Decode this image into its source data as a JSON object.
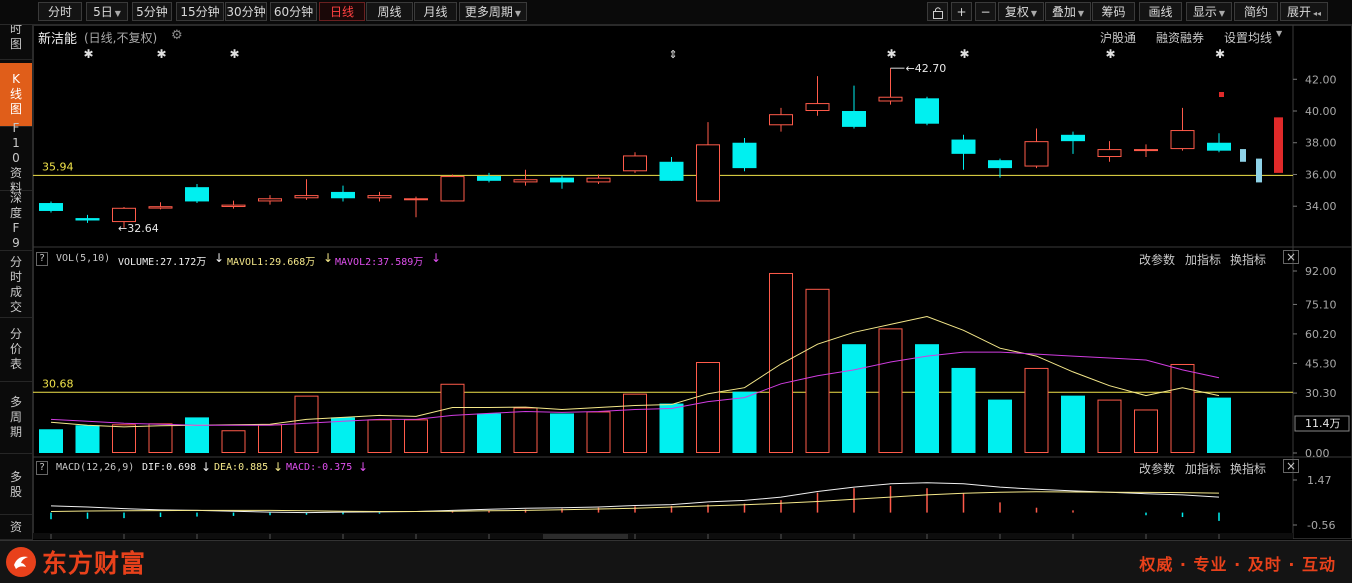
{
  "toolbar": {
    "left": [
      {
        "label": "分时",
        "caret": false,
        "active": false
      },
      {
        "label": "5日",
        "caret": true,
        "active": false
      },
      {
        "label": "5分钟",
        "caret": false,
        "active": false
      },
      {
        "label": "15分钟",
        "caret": false,
        "active": false
      },
      {
        "label": "30分钟",
        "caret": false,
        "active": false
      },
      {
        "label": "60分钟",
        "caret": false,
        "active": false
      },
      {
        "label": "日线",
        "caret": false,
        "active": true
      },
      {
        "label": "周线",
        "caret": false,
        "active": false
      },
      {
        "label": "月线",
        "caret": false,
        "active": false
      },
      {
        "label": "更多周期",
        "caret": true,
        "active": false
      }
    ],
    "right": [
      {
        "label": "复权",
        "caret": true
      },
      {
        "label": "叠加",
        "caret": true
      },
      {
        "label": "筹码",
        "caret": false
      },
      {
        "label": "画线",
        "caret": false
      },
      {
        "label": "显示",
        "caret": true
      },
      {
        "label": "简约",
        "caret": false
      },
      {
        "label": "展开",
        "caret": false
      }
    ],
    "icons": {
      "lock": "lock-icon",
      "plus": "+",
      "minus": "−",
      "collapse": "◂◂"
    }
  },
  "sidebar": [
    {
      "label": "分时图",
      "active": false
    },
    {
      "label": "K线图",
      "active": true
    },
    {
      "label": "F10资料",
      "active": false
    },
    {
      "label": "深度F9",
      "active": false
    },
    {
      "label": "分时成交",
      "active": false
    },
    {
      "label": "分价表",
      "active": false
    },
    {
      "label": "多周期",
      "active": false
    },
    {
      "label": "多股",
      "active": false
    },
    {
      "label": "资",
      "active": false
    }
  ],
  "kline_header": {
    "stock_name": "新洁能",
    "mode": "(日线,不复权)",
    "links": [
      "沪股通",
      "融资融券",
      "设置均线"
    ],
    "ref_line_label": "35.94",
    "max_label": "42.70",
    "min_label": "32.64"
  },
  "vol_header": {
    "help": "?",
    "name": "VOL(5,10)",
    "volume": "VOLUME:27.172万",
    "mavol1": "MAVOL1:29.668万",
    "mavol2": "MAVOL2:37.589万",
    "arrow": "↓",
    "links": [
      "改参数",
      "加指标",
      "换指标"
    ],
    "close": "×",
    "ref_line_label": "30.68",
    "cursor_value": "11.4万"
  },
  "macd_header": {
    "help": "?",
    "name": "MACD(12,26,9)",
    "dif": "DIF:0.698",
    "dea": "DEA:0.885",
    "macd": "MACD:-0.375",
    "arrow": "↓",
    "links": [
      "改参数",
      "加指标",
      "换指标"
    ],
    "close": "×"
  },
  "axes": {
    "price_ticks": [
      "42.00",
      "40.00",
      "38.00",
      "36.00",
      "34.00"
    ],
    "vol_ticks": [
      "92.00",
      "75.10",
      "60.20",
      "45.30",
      "30.30",
      "0.00"
    ],
    "macd_ticks": [
      "1.47",
      "-0.56"
    ]
  },
  "colors": {
    "up": "#ff5b4a",
    "down": "#00f0f0",
    "ref": "#f0e24a",
    "ma1": "#f5e88a",
    "ma2": "#d03ce0",
    "accent": "#e8411b"
  },
  "chart_data": {
    "type": "candlestick",
    "price_ref": 35.94,
    "vol_ref": 30.68,
    "candles": [
      {
        "o": 34.2,
        "c": 33.7,
        "h": 34.3,
        "l": 33.6,
        "v": 12.0
      },
      {
        "o": 33.25,
        "c": 33.1,
        "h": 33.45,
        "l": 32.95,
        "v": 14.0
      },
      {
        "o": 33.0,
        "c": 33.9,
        "h": 33.95,
        "l": 32.64,
        "v": 14.5
      },
      {
        "o": 33.85,
        "c": 34.0,
        "h": 34.25,
        "l": 33.8,
        "v": 15.0
      },
      {
        "o": 35.2,
        "c": 34.3,
        "h": 35.4,
        "l": 34.2,
        "v": 18.0
      },
      {
        "o": 33.95,
        "c": 34.1,
        "h": 34.35,
        "l": 33.85,
        "v": 11.5
      },
      {
        "o": 34.3,
        "c": 34.5,
        "h": 34.7,
        "l": 34.1,
        "v": 14.5
      },
      {
        "o": 34.5,
        "c": 34.7,
        "h": 35.7,
        "l": 34.4,
        "v": 29.0
      },
      {
        "o": 34.9,
        "c": 34.5,
        "h": 35.3,
        "l": 34.3,
        "v": 18.0
      },
      {
        "o": 34.5,
        "c": 34.7,
        "h": 34.9,
        "l": 34.3,
        "v": 17.0
      },
      {
        "o": 34.5,
        "c": 34.5,
        "h": 34.6,
        "l": 33.3,
        "v": 17.0
      },
      {
        "o": 34.3,
        "c": 35.9,
        "h": 36.0,
        "l": 34.3,
        "v": 35.0
      },
      {
        "o": 35.9,
        "c": 35.6,
        "h": 36.1,
        "l": 35.5,
        "v": 20.0
      },
      {
        "o": 35.5,
        "c": 35.7,
        "h": 36.3,
        "l": 35.3,
        "v": 23.0
      },
      {
        "o": 35.8,
        "c": 35.5,
        "h": 35.9,
        "l": 35.1,
        "v": 20.0
      },
      {
        "o": 35.5,
        "c": 35.8,
        "h": 36.0,
        "l": 35.4,
        "v": 21.0
      },
      {
        "o": 36.2,
        "c": 37.2,
        "h": 37.4,
        "l": 36.1,
        "v": 30.0
      },
      {
        "o": 36.8,
        "c": 35.6,
        "h": 37.1,
        "l": 35.6,
        "v": 25.0
      },
      {
        "o": 34.3,
        "c": 37.9,
        "h": 39.3,
        "l": 34.3,
        "v": 46.0
      },
      {
        "o": 38.0,
        "c": 36.4,
        "h": 38.3,
        "l": 36.2,
        "v": 31.0
      },
      {
        "o": 39.1,
        "c": 39.8,
        "h": 40.2,
        "l": 38.7,
        "v": 91.0
      },
      {
        "o": 40.0,
        "c": 40.5,
        "h": 42.2,
        "l": 39.7,
        "v": 83.0
      },
      {
        "o": 40.0,
        "c": 39.0,
        "h": 41.6,
        "l": 38.9,
        "v": 55.0
      },
      {
        "o": 40.6,
        "c": 40.9,
        "h": 42.7,
        "l": 40.4,
        "v": 63.0
      },
      {
        "o": 40.8,
        "c": 39.2,
        "h": 40.9,
        "l": 39.1,
        "v": 55.0
      },
      {
        "o": 38.2,
        "c": 37.3,
        "h": 38.5,
        "l": 36.3,
        "v": 43.0
      },
      {
        "o": 36.9,
        "c": 36.4,
        "h": 37.0,
        "l": 35.8,
        "v": 27.0
      },
      {
        "o": 36.5,
        "c": 38.1,
        "h": 38.9,
        "l": 36.4,
        "v": 43.0
      },
      {
        "o": 38.5,
        "c": 38.1,
        "h": 38.7,
        "l": 37.3,
        "v": 29.0
      },
      {
        "o": 37.1,
        "c": 37.6,
        "h": 38.1,
        "l": 36.8,
        "v": 27.0
      },
      {
        "o": 37.5,
        "c": 37.6,
        "h": 37.9,
        "l": 37.1,
        "v": 22.0
      },
      {
        "o": 37.6,
        "c": 38.8,
        "h": 40.2,
        "l": 37.5,
        "v": 45.0
      },
      {
        "o": 38.0,
        "c": 37.5,
        "h": 38.6,
        "l": 37.4,
        "v": 28.0
      }
    ],
    "tail_marks": [
      {
        "o": 37.6,
        "c": 36.8,
        "color": "#8fd3e8"
      },
      {
        "o": 37.0,
        "c": 35.5,
        "color": "#8fd3e8"
      },
      {
        "o": 39.6,
        "c": 36.1,
        "color": "#e02a2a"
      }
    ],
    "mavol1": [
      15.5,
      14.0,
      13.2,
      13.8,
      14.0,
      14.3,
      14.5,
      17.0,
      18.0,
      19.0,
      18.5,
      23.0,
      23.0,
      23.2,
      22.0,
      23.0,
      24.0,
      24.5,
      30.0,
      33.0,
      45.0,
      55.0,
      61.0,
      65.0,
      69.0,
      62.0,
      53.0,
      49.0,
      41.0,
      34.0,
      29.0,
      33.0,
      29.0
    ],
    "mavol2": [
      17.0,
      16.0,
      15.0,
      14.5,
      14.0,
      14.0,
      14.0,
      15.0,
      16.0,
      17.0,
      17.0,
      19.0,
      20.0,
      21.0,
      20.5,
      21.0,
      22.0,
      22.5,
      26.0,
      28.0,
      35.0,
      39.0,
      42.0,
      46.0,
      49.0,
      51.0,
      51.0,
      50.0,
      49.0,
      48.0,
      47.0,
      42.0,
      38.0
    ],
    "macd_range": [
      -0.56,
      1.47
    ],
    "dif": [
      0.3,
      0.25,
      0.18,
      0.12,
      0.1,
      0.06,
      0.02,
      0.0,
      0.02,
      0.03,
      0.05,
      0.1,
      0.15,
      0.2,
      0.22,
      0.25,
      0.32,
      0.36,
      0.48,
      0.55,
      0.7,
      0.95,
      1.15,
      1.3,
      1.35,
      1.3,
      1.15,
      1.05,
      0.98,
      0.92,
      0.85,
      0.8,
      0.7
    ],
    "dea": [
      0.05,
      0.07,
      0.08,
      0.09,
      0.1,
      0.1,
      0.1,
      0.08,
      0.06,
      0.05,
      0.05,
      0.06,
      0.08,
      0.1,
      0.13,
      0.16,
      0.2,
      0.25,
      0.3,
      0.35,
      0.42,
      0.5,
      0.6,
      0.7,
      0.8,
      0.87,
      0.92,
      0.94,
      0.93,
      0.92,
      0.91,
      0.9,
      0.88
    ],
    "macd": [
      -0.3,
      -0.28,
      -0.25,
      -0.2,
      -0.18,
      -0.15,
      -0.12,
      -0.1,
      -0.08,
      -0.05,
      0.0,
      0.05,
      0.1,
      0.14,
      0.18,
      0.22,
      0.28,
      0.3,
      0.36,
      0.4,
      0.56,
      0.9,
      1.1,
      1.2,
      1.1,
      0.86,
      0.46,
      0.22,
      0.1,
      0.0,
      -0.12,
      -0.2,
      -0.375
    ],
    "star_marks": [
      1,
      3,
      5,
      23,
      25,
      29,
      32
    ],
    "arrow_marks": [
      17
    ]
  },
  "footer": {
    "brand": "东方财富",
    "slogan": "权威 · 专业 · 及时 · 互动"
  }
}
